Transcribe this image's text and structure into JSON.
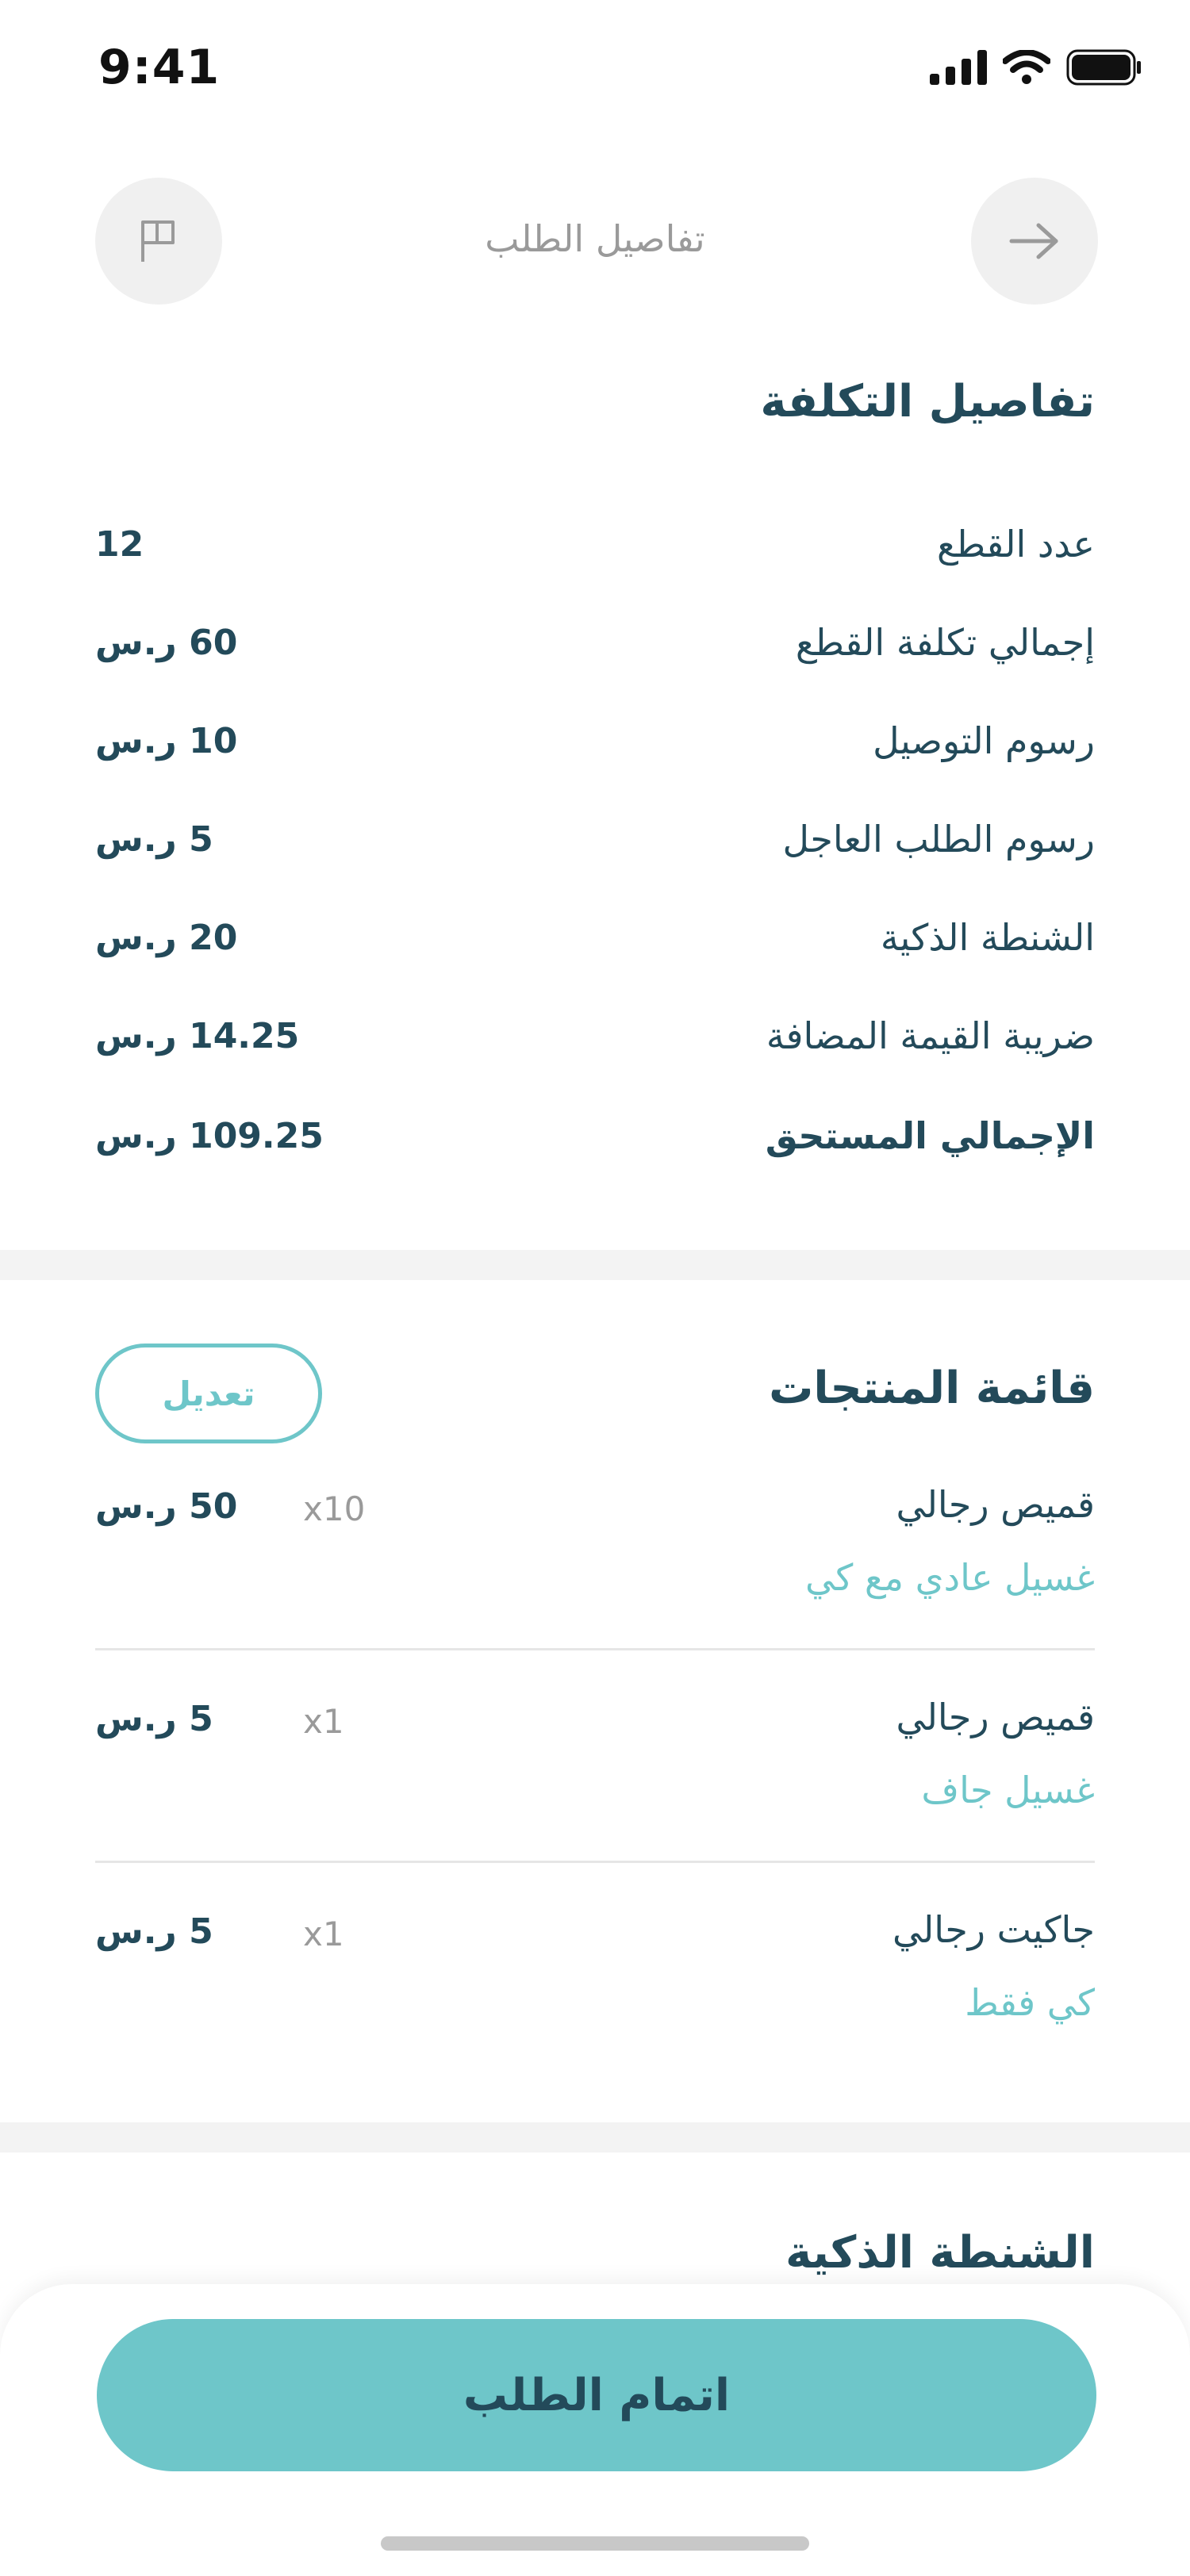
{
  "status_bar": {
    "time": "9:41"
  },
  "header": {
    "title": "تفاصيل الطلب",
    "flag_icon": "flag-icon",
    "back_icon": "arrow-right-icon"
  },
  "cost": {
    "title": "تفاصيل التكلفة",
    "rows": [
      {
        "label": "عدد القطع",
        "value": "12"
      },
      {
        "label": "إجمالي تكلفة القطع",
        "value": "60 ر.س"
      },
      {
        "label": "رسوم التوصيل",
        "value": "10 ر.س"
      },
      {
        "label": "رسوم الطلب العاجل",
        "value": "5 ر.س"
      },
      {
        "label": "الشنطة الذكية",
        "value": "20 ر.س"
      },
      {
        "label": "ضريبة القيمة المضافة",
        "value": "14.25 ر.س"
      },
      {
        "label": "الإجمالي المستحق",
        "value": "109.25 ر.س"
      }
    ]
  },
  "products": {
    "title": "قائمة المنتجات",
    "edit_label": "تعديل",
    "items": [
      {
        "name": "قميص رجالي",
        "service": "غسيل عادي مع كي",
        "qty": "x10",
        "price": "50 ر.س"
      },
      {
        "name": "قميص رجالي",
        "service": "غسيل جاف",
        "qty": "x1",
        "price": "5 ر.س"
      },
      {
        "name": "جاكيت رجالي",
        "service": "كي فقط",
        "qty": "x1",
        "price": "5 ر.س"
      }
    ]
  },
  "smart_bag": {
    "title": "الشنطة الذكية"
  },
  "footer": {
    "complete_label": "اتمام الطلب"
  },
  "colors": {
    "accent": "#6ec6c9",
    "text": "#234a5a",
    "muted": "#9a9a9a",
    "divider": "#f3f3f3"
  }
}
